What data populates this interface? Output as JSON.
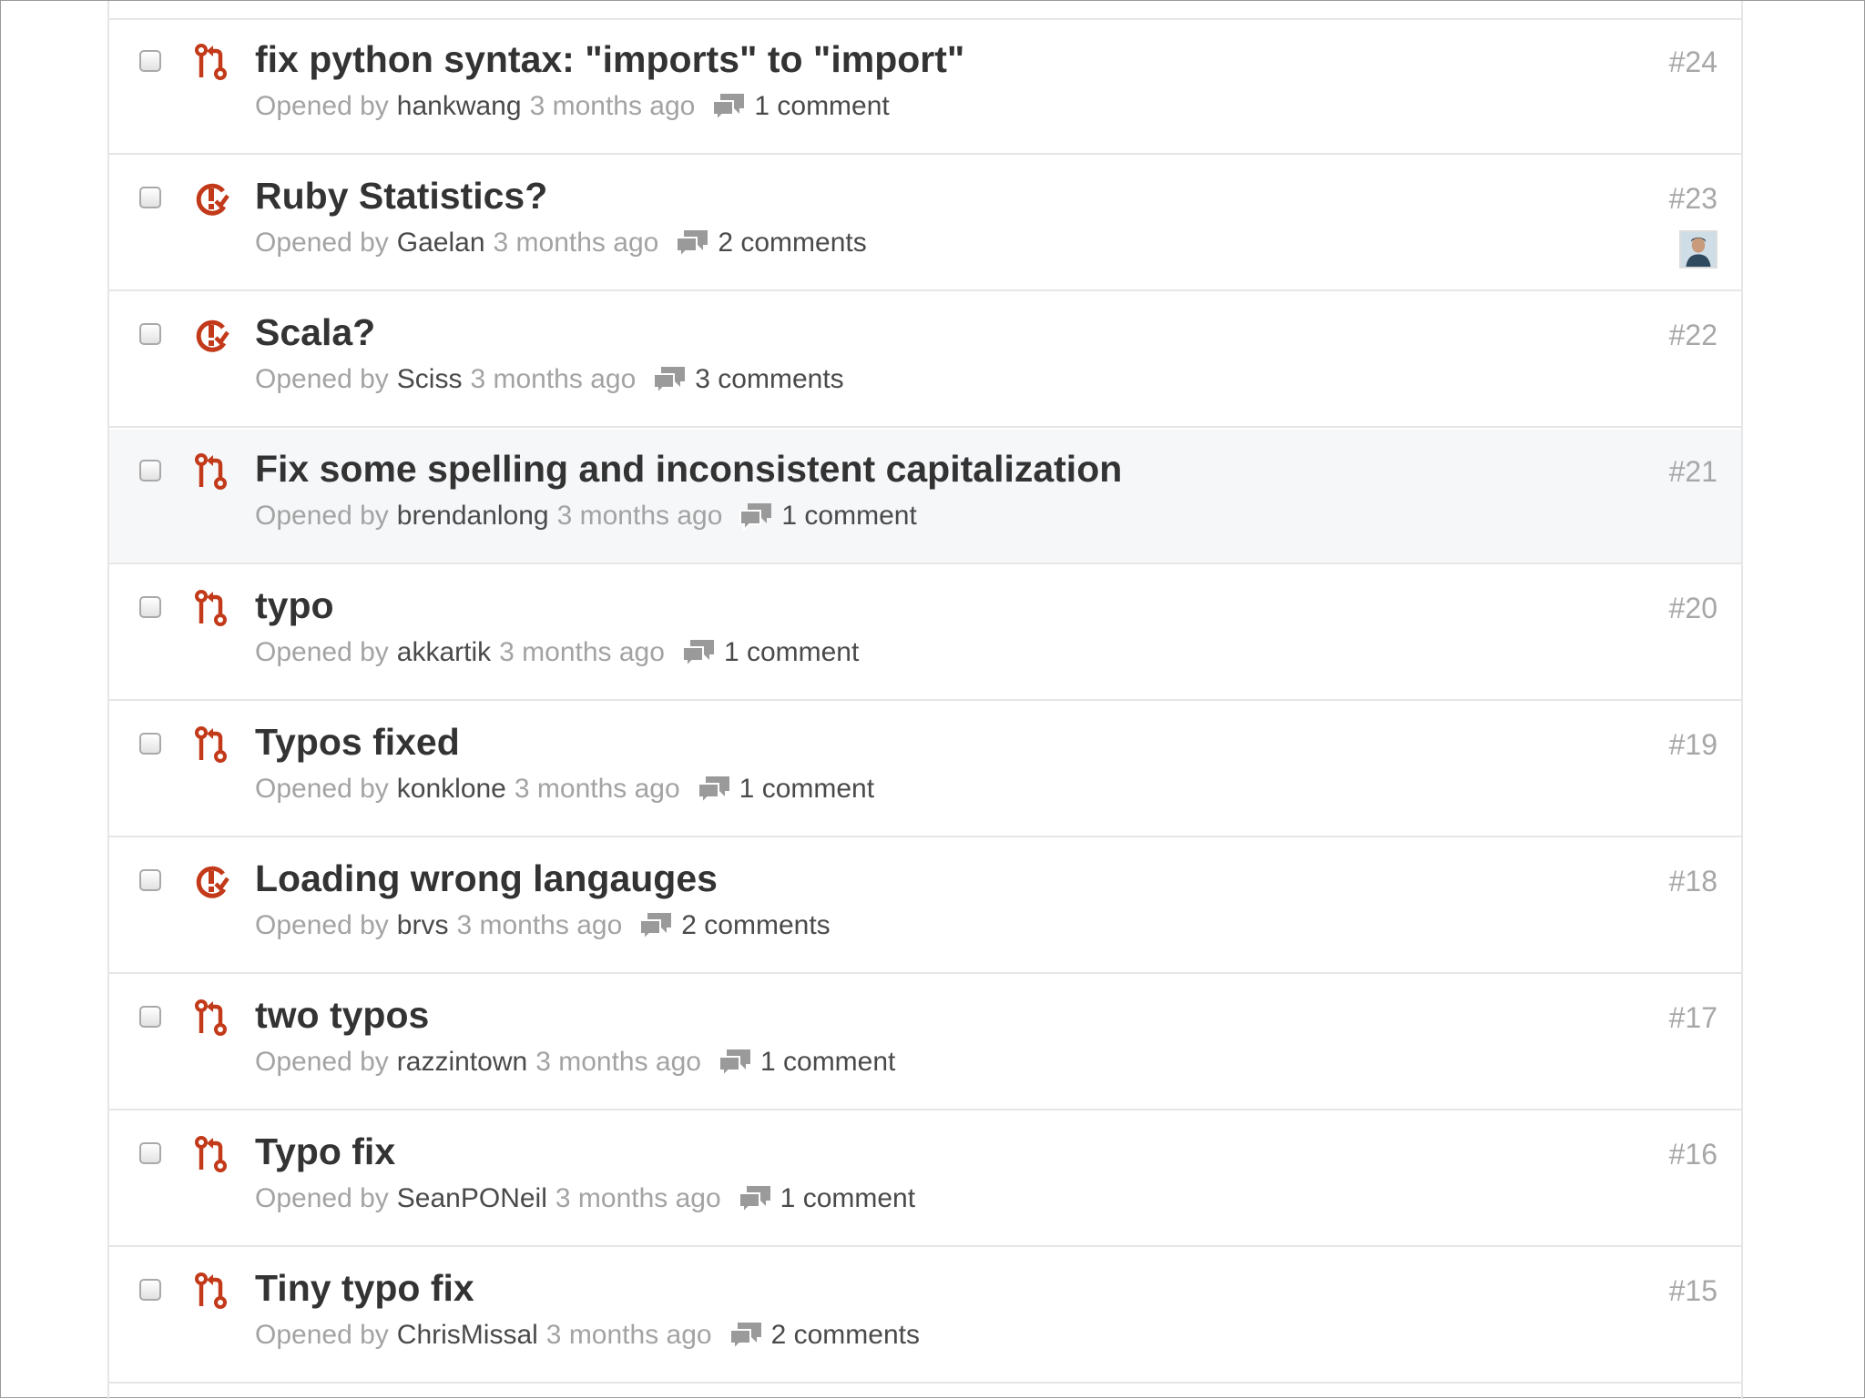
{
  "colors": {
    "icon_red": "#c23a19",
    "title_text": "#333333",
    "muted_text": "#a3a3a3",
    "author_text": "#4a4a4a",
    "comment_icon": "#9a9a9a",
    "row_border": "#e6e6e6",
    "highlight_bg": "#f5f7f9"
  },
  "issues": [
    {
      "type": "pull-request",
      "title": "fix python syntax: \"imports\" to \"import\"",
      "opened_by_label": "Opened by",
      "author": "hankwang",
      "age": "3 months ago",
      "comments": "1 comment",
      "number": "#24",
      "highlighted": false,
      "has_assignee": false
    },
    {
      "type": "issue",
      "title": "Ruby Statistics?",
      "opened_by_label": "Opened by",
      "author": "Gaelan",
      "age": "3 months ago",
      "comments": "2 comments",
      "number": "#23",
      "highlighted": false,
      "has_assignee": true
    },
    {
      "type": "issue",
      "title": "Scala?",
      "opened_by_label": "Opened by",
      "author": "Sciss",
      "age": "3 months ago",
      "comments": "3 comments",
      "number": "#22",
      "highlighted": false,
      "has_assignee": false
    },
    {
      "type": "pull-request",
      "title": "Fix some spelling and inconsistent capitalization",
      "opened_by_label": "Opened by",
      "author": "brendanlong",
      "age": "3 months ago",
      "comments": "1 comment",
      "number": "#21",
      "highlighted": true,
      "has_assignee": false
    },
    {
      "type": "pull-request",
      "title": "typo",
      "opened_by_label": "Opened by",
      "author": "akkartik",
      "age": "3 months ago",
      "comments": "1 comment",
      "number": "#20",
      "highlighted": false,
      "has_assignee": false
    },
    {
      "type": "pull-request",
      "title": "Typos fixed",
      "opened_by_label": "Opened by",
      "author": "konklone",
      "age": "3 months ago",
      "comments": "1 comment",
      "number": "#19",
      "highlighted": false,
      "has_assignee": false
    },
    {
      "type": "issue",
      "title": "Loading wrong langauges",
      "opened_by_label": "Opened by",
      "author": "brvs",
      "age": "3 months ago",
      "comments": "2 comments",
      "number": "#18",
      "highlighted": false,
      "has_assignee": false
    },
    {
      "type": "pull-request",
      "title": "two typos",
      "opened_by_label": "Opened by",
      "author": "razzintown",
      "age": "3 months ago",
      "comments": "1 comment",
      "number": "#17",
      "highlighted": false,
      "has_assignee": false
    },
    {
      "type": "pull-request",
      "title": "Typo fix",
      "opened_by_label": "Opened by",
      "author": "SeanPONeil",
      "age": "3 months ago",
      "comments": "1 comment",
      "number": "#16",
      "highlighted": false,
      "has_assignee": false
    },
    {
      "type": "pull-request",
      "title": "Tiny typo fix",
      "opened_by_label": "Opened by",
      "author": "ChrisMissal",
      "age": "3 months ago",
      "comments": "2 comments",
      "number": "#15",
      "highlighted": false,
      "has_assignee": false
    }
  ]
}
